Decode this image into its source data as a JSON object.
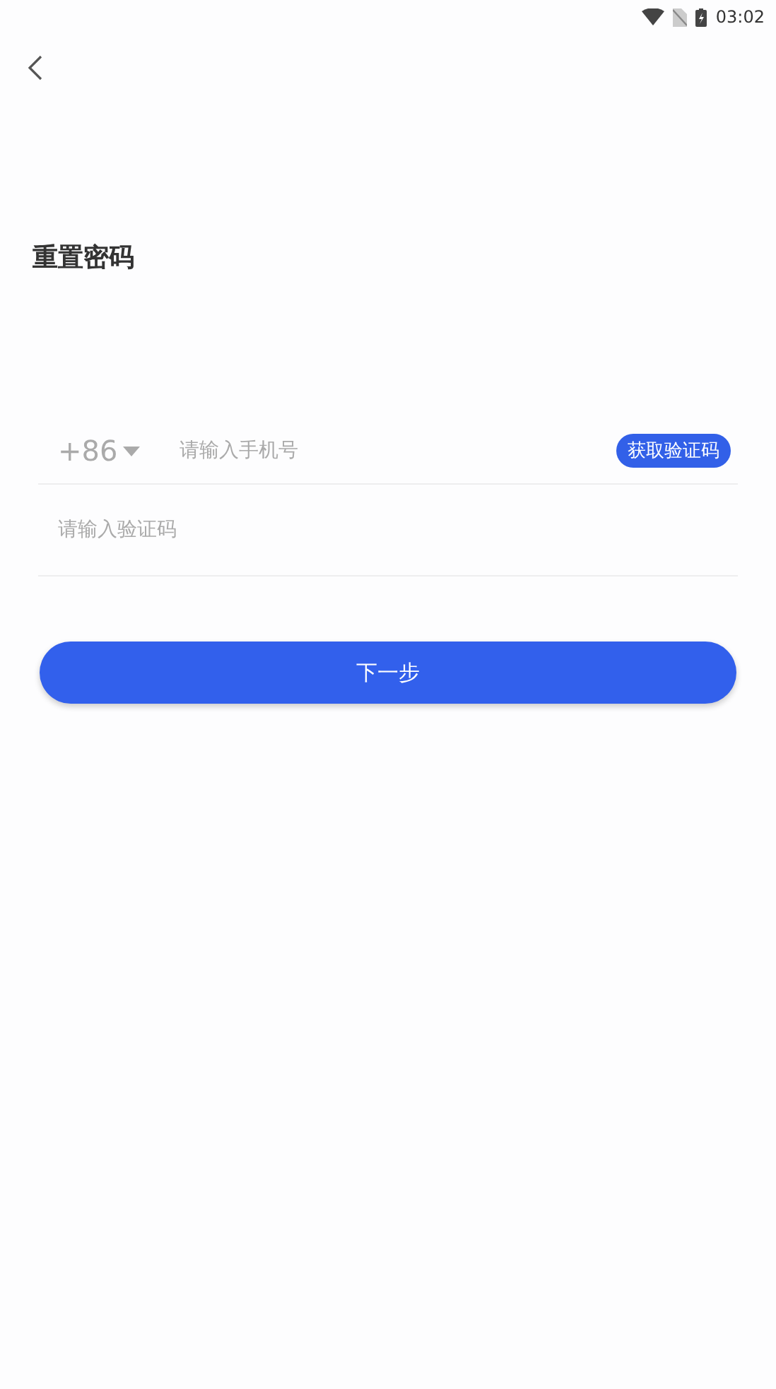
{
  "status_bar": {
    "time": "03:02"
  },
  "title": "重置密码",
  "phone": {
    "country_code": "+86",
    "placeholder": "请输入手机号",
    "code_button": "获取验证码"
  },
  "code": {
    "placeholder": "请输入验证码"
  },
  "next_button": "下一步"
}
